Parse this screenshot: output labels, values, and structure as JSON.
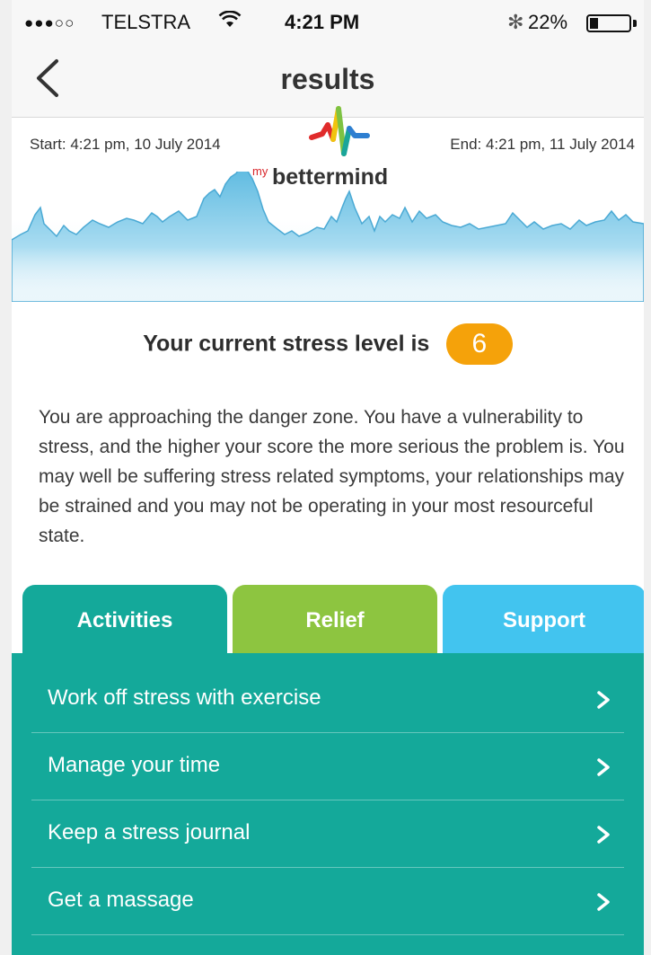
{
  "status_bar": {
    "signal": "●●●○○",
    "carrier": "TELSTRA",
    "wifi_icon": "wifi-icon",
    "time": "4:21 PM",
    "bluetooth": "✻",
    "battery_pct": "22%",
    "battery_level": 0.22
  },
  "nav": {
    "title": "results",
    "back_icon": "chevron-left-icon"
  },
  "graph": {
    "start": "Start: 4:21 pm, 10 July 2014",
    "end": "End: 4:21 pm, 11 July 2014",
    "logo_prefix": "my",
    "logo_name": "bettermind",
    "wave_color": "#5bb9e0"
  },
  "stress": {
    "label": "Your current stress level is",
    "value": "6",
    "badge_color": "#f5a20a"
  },
  "description": "You are approaching the danger zone. You have a vulnerability to stress, and the higher your score the more serious the problem is. You may well be suffering stress related symptoms, your relationships may be strained and you may not be operating in your most resourceful state.",
  "tabs": [
    {
      "label": "Activities",
      "color": "#14a99a",
      "selected": true
    },
    {
      "label": "Relief",
      "color": "#8dc540",
      "selected": false
    },
    {
      "label": "Support",
      "color": "#42c4ef",
      "selected": false
    }
  ],
  "activities": [
    {
      "label": "Work off stress with exercise"
    },
    {
      "label": "Manage your time"
    },
    {
      "label": "Keep a stress journal"
    },
    {
      "label": "Get a massage"
    }
  ]
}
